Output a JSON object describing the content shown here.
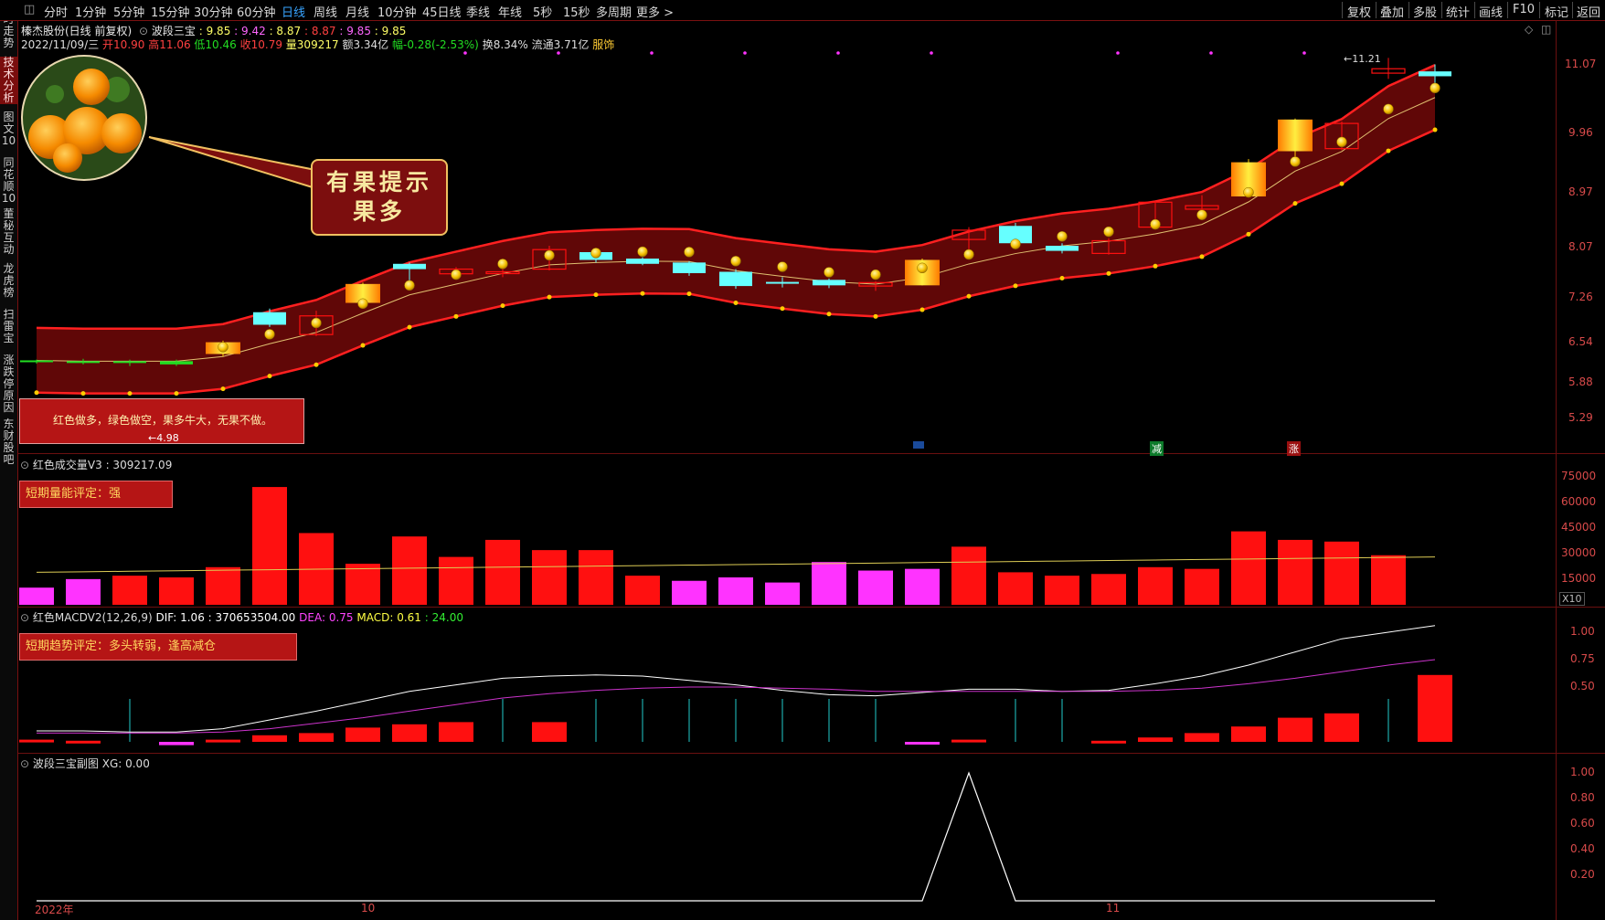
{
  "toolbar": {
    "left_items": [
      "分时",
      "1分钟",
      "5分钟",
      "15分钟",
      "30分钟",
      "60分钟",
      "日线",
      "周线",
      "月线",
      "10分钟",
      "45日线",
      "季线",
      "年线",
      "5秒",
      "15秒",
      "多周期",
      "更多 >"
    ],
    "active": "日线",
    "right_items": [
      "复权",
      "叠加",
      "多股",
      "统计",
      "画线",
      "F10",
      "标记",
      "返回"
    ]
  },
  "sidebar": {
    "tabs": [
      "分时走势",
      "技术分析",
      "图文10",
      "同花顺10",
      "董秘互动",
      "龙虎榜",
      "扫雷宝",
      "涨跌停原因",
      "东财股吧"
    ],
    "active": "技术分析"
  },
  "header": {
    "stock_name": "榛杰股份(日线 前复权)",
    "indicator": "波段三宝",
    "ind_values": [
      ": 9.85",
      ": 9.42",
      ": 8.87",
      ": 8.87",
      ": 9.85",
      ": 9.85"
    ],
    "date": "2022/11/09/三",
    "open": "开10.90",
    "high": "高11.06",
    "low": "低10.46",
    "close": "收10.79",
    "vol": "量309217",
    "amount": "额3.34亿",
    "change": "幅-0.28(-2.53%)",
    "turnover": "换8.34%",
    "float": "流通3.71亿",
    "service": "服饰"
  },
  "bubble": {
    "line1": "有果提示",
    "line2": "果多"
  },
  "legend_box": {
    "text": "红色做多，绿色做空，果多牛大，无果不做。",
    "min_marker": "←4.98"
  },
  "max_marker": "11.21",
  "signals": {
    "reduce": "减",
    "rise": "涨"
  },
  "price_axis": [
    "11.07",
    "9.96",
    "8.97",
    "8.07",
    "7.26",
    "6.54",
    "5.88",
    "5.29"
  ],
  "volume_pane": {
    "title": "红色成交量V3",
    "value": ": 309217.09",
    "eval": "短期量能评定：强",
    "axis": [
      "75000",
      "60000",
      "45000",
      "30000",
      "15000"
    ],
    "unit": "X10"
  },
  "macd_pane": {
    "title": "红色MACDV2(12,26,9)",
    "dif": "DIF: 1.06",
    "dif_value": ": 370653504.00",
    "dea": "DEA: 0.75",
    "macd": "MACD: 0.61",
    "macd_value": ": 24.00",
    "eval": "短期趋势评定：多头转弱，逢高减仓",
    "axis": [
      "1.00",
      "0.75",
      "0.50"
    ]
  },
  "sub_pane": {
    "title": "波段三宝副图",
    "value": "XG: 0.00",
    "axis": [
      "1.00",
      "0.80",
      "0.60",
      "0.40",
      "0.20"
    ]
  },
  "time_axis": [
    "2022年",
    "10",
    "11"
  ],
  "colors": {
    "up": "#ff1010",
    "down": "#66ffff",
    "gold": "#ffcc00",
    "purple": "#ff33ff"
  },
  "chart_data": {
    "type": "candlestick",
    "candles": [
      {
        "o": 5.95,
        "h": 5.98,
        "l": 5.93,
        "c": 5.97,
        "t": "flat"
      },
      {
        "o": 5.96,
        "h": 5.99,
        "l": 5.92,
        "c": 5.95,
        "t": "flat"
      },
      {
        "o": 5.95,
        "h": 5.98,
        "l": 5.9,
        "c": 5.96,
        "t": "flat"
      },
      {
        "o": 5.92,
        "h": 5.98,
        "l": 5.9,
        "c": 5.96,
        "t": "flat"
      },
      {
        "o": 6.05,
        "h": 6.22,
        "l": 6.02,
        "c": 6.2,
        "t": "gold"
      },
      {
        "o": 6.43,
        "h": 6.65,
        "l": 6.4,
        "c": 6.6,
        "t": "down"
      },
      {
        "o": 6.3,
        "h": 6.62,
        "l": 6.28,
        "c": 6.55,
        "t": "up"
      },
      {
        "o": 6.73,
        "h": 7.02,
        "l": 6.7,
        "c": 7.0,
        "t": "gold"
      },
      {
        "o": 7.3,
        "h": 7.32,
        "l": 6.98,
        "c": 7.22,
        "t": "down"
      },
      {
        "o": 7.15,
        "h": 7.25,
        "l": 7.08,
        "c": 7.22,
        "t": "up"
      },
      {
        "o": 7.17,
        "h": 7.3,
        "l": 7.1,
        "c": 7.18,
        "t": "up"
      },
      {
        "o": 7.22,
        "h": 7.58,
        "l": 7.2,
        "c": 7.52,
        "t": "up"
      },
      {
        "o": 7.48,
        "h": 7.5,
        "l": 7.32,
        "c": 7.36,
        "t": "down"
      },
      {
        "o": 7.38,
        "h": 7.4,
        "l": 7.28,
        "c": 7.3,
        "t": "down"
      },
      {
        "o": 7.32,
        "h": 7.34,
        "l": 7.12,
        "c": 7.16,
        "t": "down"
      },
      {
        "o": 7.18,
        "h": 7.22,
        "l": 6.93,
        "c": 6.97,
        "t": "down"
      },
      {
        "o": 7.03,
        "h": 7.1,
        "l": 6.95,
        "c": 7.02,
        "t": "down"
      },
      {
        "o": 7.06,
        "h": 7.08,
        "l": 6.94,
        "c": 6.98,
        "t": "down"
      },
      {
        "o": 6.97,
        "h": 7.04,
        "l": 6.9,
        "c": 7.02,
        "t": "up"
      },
      {
        "o": 6.98,
        "h": 7.38,
        "l": 6.98,
        "c": 7.36,
        "t": "gold"
      },
      {
        "o": 7.68,
        "h": 7.88,
        "l": 7.48,
        "c": 7.83,
        "t": "up"
      },
      {
        "o": 7.9,
        "h": 7.95,
        "l": 7.58,
        "c": 7.62,
        "t": "down"
      },
      {
        "o": 7.58,
        "h": 7.62,
        "l": 7.46,
        "c": 7.5,
        "t": "down"
      },
      {
        "o": 7.46,
        "h": 7.7,
        "l": 7.44,
        "c": 7.66,
        "t": "up"
      },
      {
        "o": 7.88,
        "h": 8.32,
        "l": 7.85,
        "c": 8.3,
        "t": "up"
      },
      {
        "o": 8.18,
        "h": 8.42,
        "l": 8.1,
        "c": 8.24,
        "t": "up"
      },
      {
        "o": 8.4,
        "h": 9.08,
        "l": 8.4,
        "c": 9.02,
        "t": "gold"
      },
      {
        "o": 9.23,
        "h": 9.88,
        "l": 9.1,
        "c": 9.86,
        "t": "gold"
      },
      {
        "o": 9.28,
        "h": 9.82,
        "l": 9.25,
        "c": 9.78,
        "t": "up"
      },
      {
        "o": 10.96,
        "h": 11.21,
        "l": 10.73,
        "c": 10.86,
        "t": "up"
      },
      {
        "o": 10.9,
        "h": 11.06,
        "l": 10.46,
        "c": 10.79,
        "t": "down"
      }
    ],
    "volume": [
      9,
      14,
      16,
      15,
      21,
      68,
      41,
      23,
      39,
      27,
      37,
      31,
      31,
      16,
      13,
      15,
      12,
      24,
      19,
      20,
      33,
      18,
      16,
      17,
      21,
      20,
      42,
      37,
      36,
      28,
      0
    ],
    "volume_colors": [
      "m",
      "m",
      "r",
      "r",
      "r",
      "r",
      "r",
      "r",
      "r",
      "r",
      "r",
      "r",
      "r",
      "r",
      "m",
      "m",
      "m",
      "m",
      "m",
      "m",
      "r",
      "r",
      "r",
      "r",
      "r",
      "r",
      "r",
      "r",
      "r",
      "r",
      "r"
    ],
    "macd_hist": [
      0.02,
      0.01,
      0.0,
      -0.03,
      0.02,
      0.06,
      0.08,
      0.13,
      0.16,
      0.18,
      0.0,
      0.18,
      0.0,
      0.0,
      0.0,
      0.0,
      0.0,
      0.0,
      0.0,
      -0.02,
      0.02,
      0.0,
      0.0,
      0.01,
      0.04,
      0.08,
      0.14,
      0.22,
      0.26,
      0.0,
      0.61
    ],
    "dif": [
      0.1,
      0.1,
      0.09,
      0.09,
      0.12,
      0.2,
      0.28,
      0.37,
      0.46,
      0.52,
      0.58,
      0.6,
      0.61,
      0.6,
      0.56,
      0.52,
      0.47,
      0.43,
      0.42,
      0.45,
      0.48,
      0.48,
      0.46,
      0.47,
      0.53,
      0.6,
      0.7,
      0.82,
      0.94,
      1.0,
      1.06
    ],
    "dea": [
      0.08,
      0.08,
      0.08,
      0.08,
      0.09,
      0.12,
      0.17,
      0.22,
      0.28,
      0.34,
      0.4,
      0.44,
      0.47,
      0.49,
      0.5,
      0.5,
      0.49,
      0.48,
      0.46,
      0.46,
      0.46,
      0.46,
      0.46,
      0.46,
      0.47,
      0.49,
      0.53,
      0.58,
      0.64,
      0.7,
      0.75
    ],
    "xg": [
      0,
      0,
      0,
      0,
      0,
      0,
      0,
      0,
      0,
      0,
      0,
      0,
      0,
      0,
      0,
      0,
      0,
      0,
      0,
      0,
      1,
      0,
      0,
      0,
      0,
      0,
      0,
      0,
      0,
      0,
      0
    ]
  }
}
